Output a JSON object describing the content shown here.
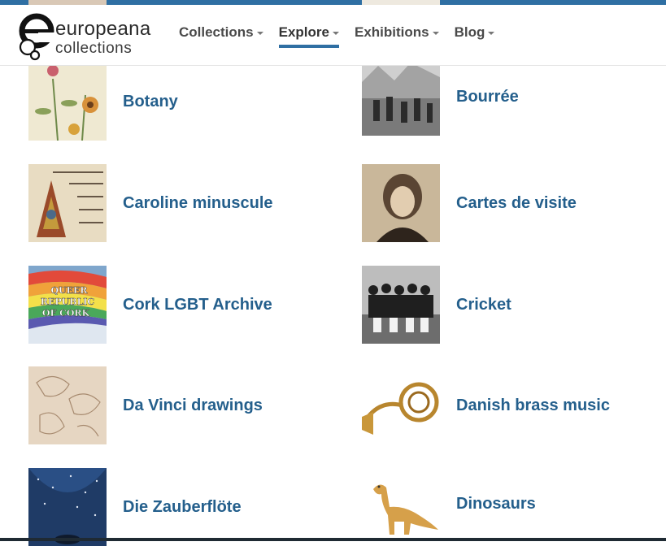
{
  "header": {
    "logo": {
      "word1": "europeana",
      "word2": "collections"
    },
    "nav": [
      {
        "label": "Collections",
        "active": false
      },
      {
        "label": "Explore",
        "active": true
      },
      {
        "label": "Exhibitions",
        "active": false
      },
      {
        "label": "Blog",
        "active": false
      }
    ]
  },
  "colors": {
    "accent": "#2f6fa3",
    "link": "#245f8c"
  },
  "topics": [
    {
      "label": "Botany",
      "image": "botany-flowers-illustration"
    },
    {
      "label": "Bourrée",
      "image": "dancers-engraving"
    },
    {
      "label": "Caroline minuscule",
      "image": "illuminated-manuscript"
    },
    {
      "label": "Cartes de visite",
      "image": "portrait-photograph"
    },
    {
      "label": "Cork LGBT Archive",
      "image": "queer-republic-of-cork-flag"
    },
    {
      "label": "Cricket",
      "image": "cricket-team-photograph"
    },
    {
      "label": "Da Vinci drawings",
      "image": "sketch-drawing"
    },
    {
      "label": "Danish brass music",
      "image": "french-horn"
    },
    {
      "label": "Die Zauberflöte",
      "image": "starry-night-stage-design"
    },
    {
      "label": "Dinosaurs",
      "image": "dinosaur-toy"
    }
  ],
  "flag_text": [
    "QUEER",
    "REPUBLIC",
    "OF CORK"
  ]
}
